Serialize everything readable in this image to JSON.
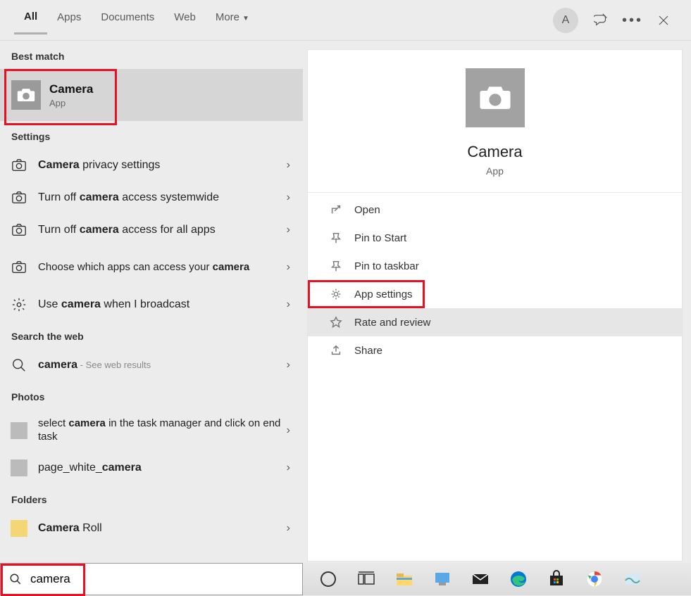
{
  "tabs": {
    "all": "All",
    "apps": "Apps",
    "documents": "Documents",
    "web": "Web",
    "more": "More"
  },
  "avatar_letter": "A",
  "sections": {
    "best": "Best match",
    "settings": "Settings",
    "searchweb": "Search the web",
    "photos": "Photos",
    "folders": "Folders"
  },
  "best": {
    "title": "Camera",
    "sub": "App"
  },
  "settings_rows": [
    {
      "pre": "",
      "bold": "Camera",
      "post": " privacy settings"
    },
    {
      "pre": "Turn off ",
      "bold": "camera",
      "post": " access systemwide"
    },
    {
      "pre": "Turn off ",
      "bold": "camera",
      "post": " access for all apps"
    },
    {
      "pre": "Choose which apps can access your ",
      "bold": "camera",
      "post": ""
    },
    {
      "pre": "Use ",
      "bold": "camera",
      "post": " when I broadcast"
    }
  ],
  "web": {
    "bold": "camera",
    "sub": " - See web results"
  },
  "photos_rows": [
    {
      "pre": "select ",
      "bold": "camera",
      "post": " in the task manager and click on end task"
    },
    {
      "pre": "page_white_",
      "bold": "camera",
      "post": ""
    }
  ],
  "folders_rows": [
    {
      "bold": "Camera",
      "post": " Roll"
    }
  ],
  "right": {
    "title": "Camera",
    "sub": "App"
  },
  "actions": {
    "open": "Open",
    "pin_start": "Pin to Start",
    "pin_taskbar": "Pin to taskbar",
    "app_settings": "App settings",
    "rate": "Rate and review",
    "share": "Share"
  },
  "search_value": "camera"
}
